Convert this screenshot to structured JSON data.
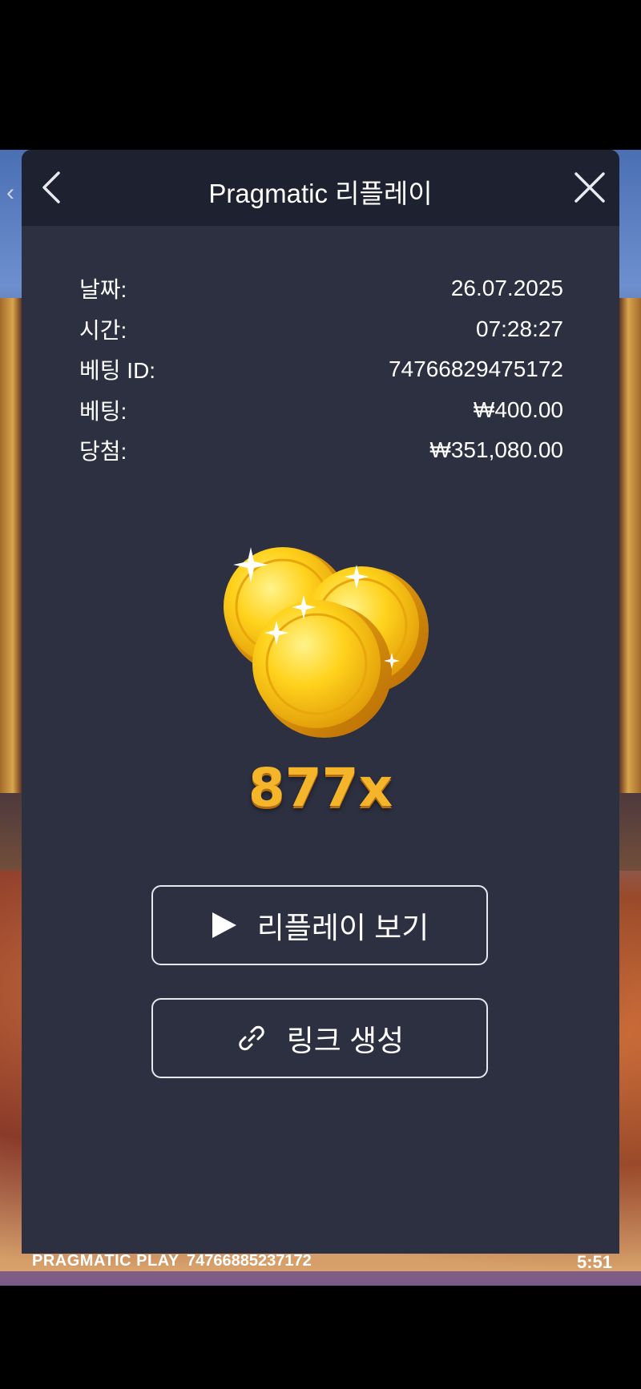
{
  "modal": {
    "title": "Pragmatic 리플레이",
    "back_icon": "chevron-left-icon",
    "close_icon": "close-icon"
  },
  "details": [
    {
      "label": "날짜:",
      "value": "26.07.2025"
    },
    {
      "label": "시간:",
      "value": "07:28:27"
    },
    {
      "label": "베팅 ID:",
      "value": "74766829475172"
    },
    {
      "label": "베팅:",
      "value": "₩400.00"
    },
    {
      "label": "당첨:",
      "value": "₩351,080.00"
    }
  ],
  "win": {
    "multiplier": "877x",
    "image": "gold-coins-icon"
  },
  "actions": {
    "replay_label": "리플레이 보기",
    "replay_icon": "play-icon",
    "link_label": "링크 생성",
    "link_icon": "link-icon"
  },
  "game_footer": {
    "brand": "PRAGMATIC PLAY",
    "round_id": "74766885237172",
    "clock": "5:51"
  },
  "colors": {
    "modal_bg": "#2d3040",
    "header_bg": "#1e2130",
    "multiplier": "#f5b52a"
  }
}
